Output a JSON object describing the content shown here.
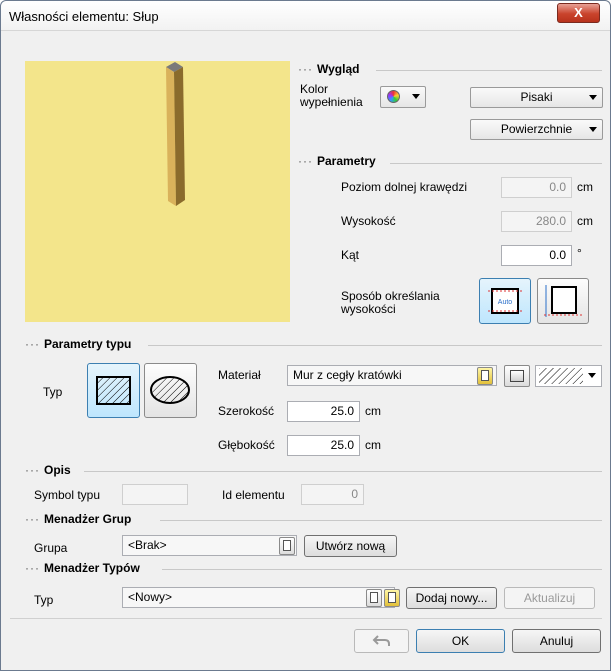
{
  "window": {
    "title": "Własności elementu: Słup",
    "close_label": "X"
  },
  "appearance": {
    "header": "Wygląd",
    "fill_color_label": "Kolor\nwypełnienia",
    "pens_label": "Pisaki",
    "surfaces_label": "Powierzchnie"
  },
  "parameters": {
    "header": "Parametry",
    "bottom_edge_label": "Poziom dolnej krawędzi",
    "bottom_edge_value": "0.0",
    "height_label": "Wysokość",
    "height_value": "280.0",
    "angle_label": "Kąt",
    "angle_value": "0.0",
    "unit_cm": "cm",
    "unit_deg": "°",
    "height_mode_label": "Sposób określania\nwysokości",
    "auto_label": "Auto"
  },
  "type_params": {
    "header": "Parametry typu",
    "type_label": "Typ",
    "material_label": "Materiał",
    "material_value": "Mur z cegły kratówki",
    "width_label": "Szerokość",
    "width_value": "25.0",
    "depth_label": "Głębokość",
    "depth_value": "25.0"
  },
  "description": {
    "header": "Opis",
    "type_symbol_label": "Symbol typu",
    "type_symbol_value": "",
    "element_id_label": "Id elementu",
    "element_id_value": "0"
  },
  "group_manager": {
    "header": "Menadżer Grup",
    "group_label": "Grupa",
    "group_value": "<Brak>",
    "create_new_label": "Utwórz nową"
  },
  "type_manager": {
    "header": "Menadżer Typów",
    "type_label": "Typ",
    "type_value": "<Nowy>",
    "add_new_label": "Dodaj nowy...",
    "update_label": "Aktualizuj"
  },
  "footer": {
    "ok_label": "OK",
    "cancel_label": "Anuluj"
  },
  "colors": {
    "preview_bg": "#f3e58b",
    "column": "#c9a24e",
    "selected_btn": "#bee6fd"
  }
}
